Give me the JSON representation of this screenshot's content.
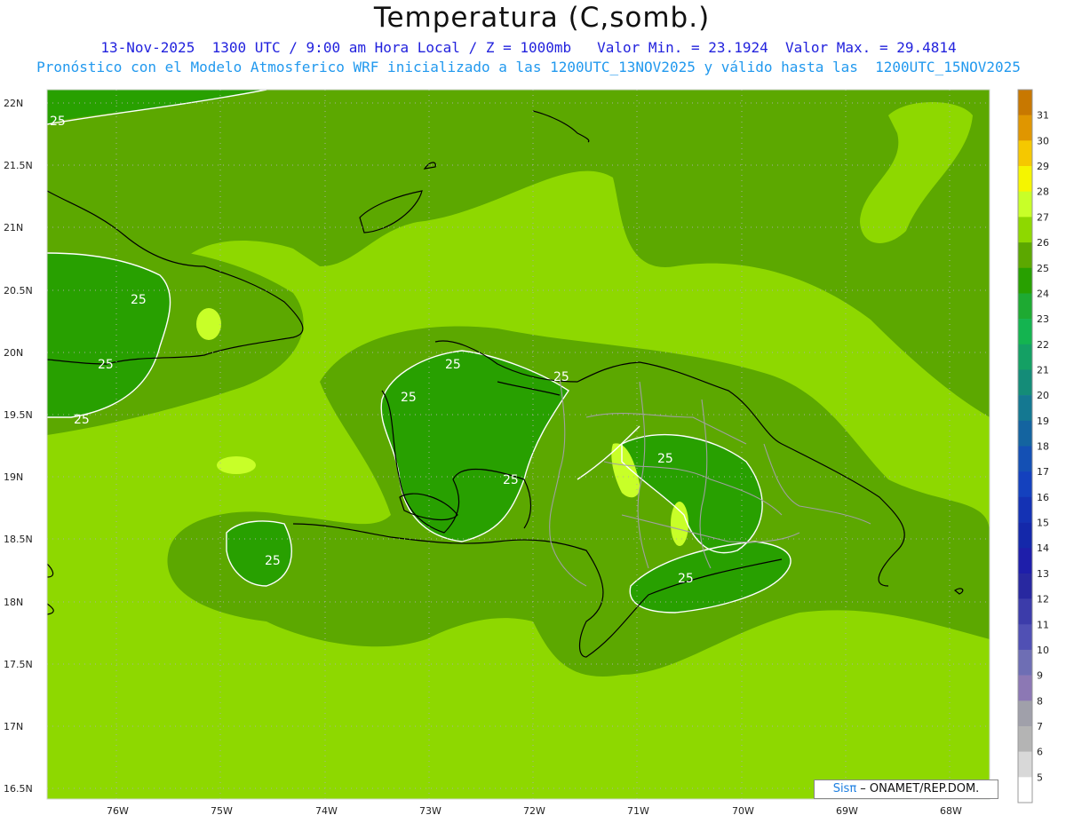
{
  "header": {
    "title": "Temperatura (C,somb.)",
    "line1": "13-Nov-2025  1300 UTC / 9:00 am Hora Local / Z = 1000mb   Valor Min. = 23.1924  Valor Max. = 29.4814",
    "line2": "Pronóstico con el Modelo Atmosferico WRF inicializado a las 1200UTC_13NOV2025 y válido hasta las  1200UTC_15NOV2025"
  },
  "axes": {
    "lat_labels": [
      "22N",
      "21.5N",
      "21N",
      "20.5N",
      "20N",
      "19.5N",
      "19N",
      "18.5N",
      "18N",
      "17.5N",
      "17N",
      "16.5N"
    ],
    "lon_labels": [
      "76W",
      "75W",
      "74W",
      "73W",
      "72W",
      "71W",
      "70W",
      "69W",
      "68W"
    ]
  },
  "contour_labels": [
    "25",
    "25",
    "25",
    "25",
    "25",
    "25",
    "25",
    "25",
    "25",
    "25",
    "25"
  ],
  "colorbar": {
    "labels": [
      "31",
      "30",
      "29",
      "28",
      "27",
      "26",
      "25",
      "24",
      "23",
      "22",
      "21",
      "20",
      "19",
      "18",
      "17",
      "16",
      "15",
      "14",
      "13",
      "12",
      "11",
      "10",
      "9",
      "8",
      "7",
      "6",
      "5"
    ],
    "colors": [
      "#c87800",
      "#e09600",
      "#f5c800",
      "#f5f500",
      "#c8ff28",
      "#8ed800",
      "#5ca800",
      "#28a000",
      "#1eaa32",
      "#14b450",
      "#14a064",
      "#148c78",
      "#147891",
      "#1464a0",
      "#1450b4",
      "#1441be",
      "#1432b4",
      "#1428aa",
      "#1e1eaa",
      "#2828a0",
      "#3c3caa",
      "#5050b4",
      "#6e6eb4",
      "#8c78b4",
      "#a0a0aa",
      "#b4b4b4",
      "#d8d8d8",
      "#ffffff"
    ]
  },
  "credit": {
    "sis": "Sisπ",
    "rest": " – ONAMET/REP.DOM."
  },
  "colors": {
    "ocean_base": "#8ed800",
    "warm_band": "#5ca800",
    "cool_land": "#28a000",
    "hot_spot": "#c8ff28",
    "coast": "#000000",
    "borders": "#a0a0a0"
  }
}
